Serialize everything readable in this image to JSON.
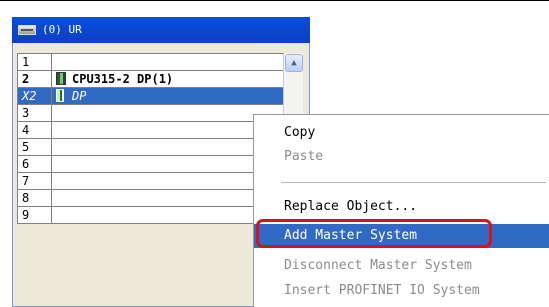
{
  "rack": {
    "title": "(0) UR",
    "icon": "rack-icon",
    "rows": [
      {
        "slot": "1",
        "module": "",
        "kind": "normal"
      },
      {
        "slot": "2",
        "module": "CPU315-2 DP(1)",
        "kind": "bold"
      },
      {
        "slot": "X2",
        "module": "DP",
        "kind": "selected"
      },
      {
        "slot": "3",
        "module": "",
        "kind": "normal"
      },
      {
        "slot": "4",
        "module": "",
        "kind": "normal"
      },
      {
        "slot": "5",
        "module": "",
        "kind": "normal"
      },
      {
        "slot": "6",
        "module": "",
        "kind": "normal"
      },
      {
        "slot": "7",
        "module": "",
        "kind": "normal"
      },
      {
        "slot": "8",
        "module": "",
        "kind": "normal"
      },
      {
        "slot": "9",
        "module": "",
        "kind": "normal"
      }
    ]
  },
  "context_menu": {
    "items": [
      {
        "label": "Copy",
        "state": "enabled"
      },
      {
        "label": "Paste",
        "state": "disabled"
      },
      {
        "label": "Replace Object...",
        "state": "enabled"
      },
      {
        "label": "Add Master System",
        "state": "highlighted"
      },
      {
        "label": "Disconnect Master System",
        "state": "disabled"
      },
      {
        "label": "Insert PROFINET IO System",
        "state": "disabled"
      }
    ]
  },
  "colors": {
    "title_bar": "#0a4fd8",
    "selection": "#316ac5",
    "annotation": "#e01010"
  }
}
